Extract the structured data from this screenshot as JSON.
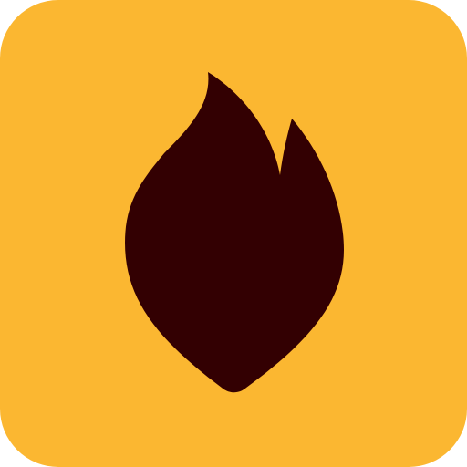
{
  "app_icon": {
    "icon_name": "flame-icon",
    "background_color": "#FBB731",
    "icon_color": "#330002"
  }
}
